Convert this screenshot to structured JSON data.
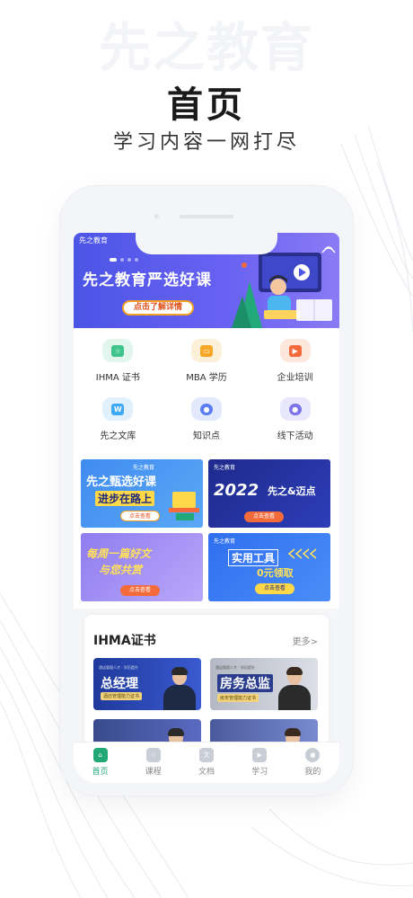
{
  "promo_header": {
    "watermark": "先之教育",
    "title": "首页",
    "subtitle": "学习内容一网打尽"
  },
  "banner": {
    "brand": "先之教育",
    "headline": "先之教育严选好课",
    "button_label": "点击了解详情"
  },
  "quick_entries": [
    {
      "label": "IHMA 证书",
      "icon": "certificate-icon",
      "color": "#3ec48c",
      "glyph": "☆"
    },
    {
      "label": "MBA 学历",
      "icon": "mba-icon",
      "color": "#f5a623",
      "glyph": "▭"
    },
    {
      "label": "企业培训",
      "icon": "training-icon",
      "color": "#f36b3b",
      "glyph": "▶"
    },
    {
      "label": "先之文库",
      "icon": "library-icon",
      "color": "#3fa9f5",
      "glyph": "W"
    },
    {
      "label": "知识点",
      "icon": "knowledge-icon",
      "color": "#5b7df2",
      "glyph": "●"
    },
    {
      "label": "线下活动",
      "icon": "activity-icon",
      "color": "#7b73e8",
      "glyph": "●"
    }
  ],
  "promos": [
    {
      "logo": "先之教育",
      "title_line1": "先之甄选好课",
      "title_line2": "进步在路上",
      "button": "点击查看"
    },
    {
      "logo": "先之教育",
      "title_line1": "2022",
      "title_line2": "先之&迈点",
      "button": "点击查看"
    },
    {
      "title_line1": "每周一篇好文",
      "title_line2": "与您共赏",
      "button": "点击查看"
    },
    {
      "logo": "先之教育",
      "title_line1": "实用工具",
      "title_line2": "0元领取",
      "button": "点击查看"
    }
  ],
  "ihma_section": {
    "title": "IHMA证书",
    "more": "更多>",
    "cards": [
      {
        "name": "总经理",
        "tag": "酒店管理能力证书",
        "note": "酒店管理人才 · 学历提升"
      },
      {
        "name": "房务总监",
        "tag": "房务管理能力证书",
        "note": "酒店管理人才 · 学历提升"
      },
      {
        "name": "",
        "tag": "",
        "note": ""
      },
      {
        "name": "",
        "tag": "",
        "note": ""
      }
    ]
  },
  "tabbar": [
    {
      "label": "首页",
      "icon": "home-icon",
      "active": true
    },
    {
      "label": "课程",
      "icon": "course-icon",
      "active": false
    },
    {
      "label": "文档",
      "icon": "document-icon",
      "active": false
    },
    {
      "label": "学习",
      "icon": "study-icon",
      "active": false
    },
    {
      "label": "我的",
      "icon": "profile-icon",
      "active": false
    }
  ],
  "colors": {
    "accent": "#21a876",
    "banner": "#5a5cec",
    "button_orange": "#f4a023"
  }
}
